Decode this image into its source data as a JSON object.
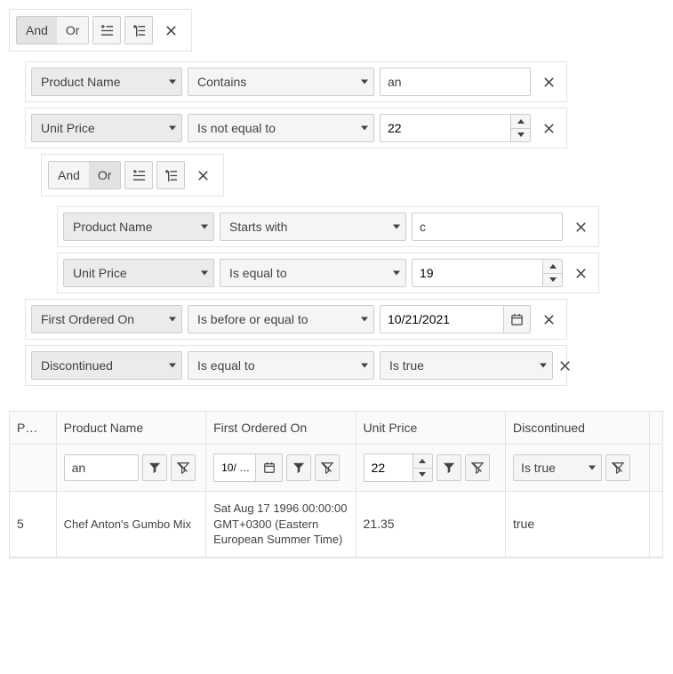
{
  "filter": {
    "group1": {
      "and": "And",
      "or": "Or",
      "selected": "and",
      "rules": [
        {
          "field": "Product Name",
          "operator": "Contains",
          "value": "an"
        },
        {
          "field": "Unit Price",
          "operator": "Is not equal to",
          "value": "22"
        }
      ],
      "group2": {
        "and": "And",
        "or": "Or",
        "selected": "or",
        "rules": [
          {
            "field": "Product Name",
            "operator": "Starts with",
            "value": "c"
          },
          {
            "field": "Unit Price",
            "operator": "Is equal to",
            "value": "19"
          }
        ]
      },
      "rules_after": [
        {
          "field": "First Ordered On",
          "operator": "Is before or equal to",
          "value": "10/21/2021"
        },
        {
          "field": "Discontinued",
          "operator": "Is equal to",
          "value": "Is true"
        }
      ]
    }
  },
  "grid": {
    "headers": {
      "id": "P…",
      "name": "Product Name",
      "date": "First Ordered On",
      "price": "Unit Price",
      "disc": "Discontinued"
    },
    "filter_row": {
      "name": "an",
      "date": "10/ …",
      "price": "22",
      "disc": "Is true"
    },
    "rows": [
      {
        "id": "5",
        "name": "Chef Anton's Gumbo Mix",
        "date": "Sat Aug 17 1996 00:00:00 GMT+0300 (Eastern European Summer Time)",
        "price": "21.35",
        "disc": "true"
      }
    ]
  }
}
